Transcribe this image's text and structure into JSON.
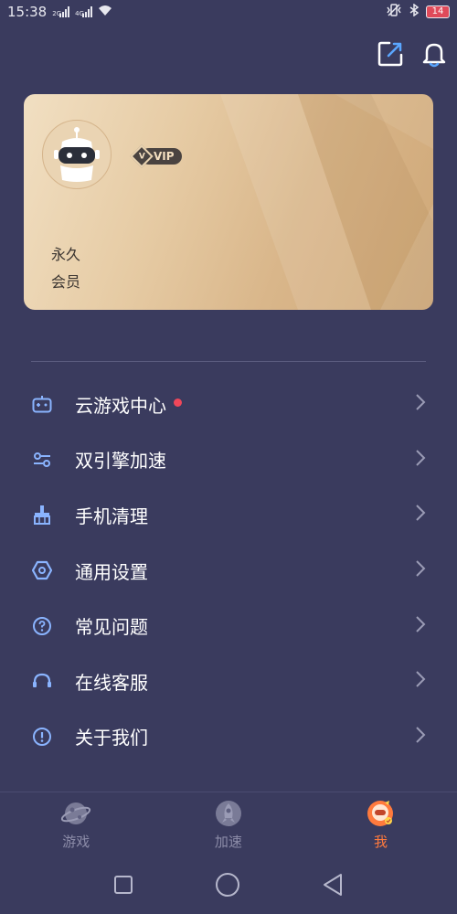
{
  "status_bar": {
    "time": "15:38",
    "net1": "2G",
    "net2": "4G",
    "battery": "14"
  },
  "header": {
    "icons": [
      "edit-icon",
      "bell-icon"
    ]
  },
  "vip_card": {
    "badge_letter": "V",
    "badge_label": "VIP",
    "member_line1": "永久",
    "member_line2": "会员"
  },
  "menu": {
    "items": [
      {
        "label": "云游戏中心",
        "icon": "gamepad-icon",
        "has_dot": true
      },
      {
        "label": "双引擎加速",
        "icon": "toggles-icon",
        "has_dot": false
      },
      {
        "label": "手机清理",
        "icon": "broom-icon",
        "has_dot": false
      },
      {
        "label": "通用设置",
        "icon": "hex-settings-icon",
        "has_dot": false
      },
      {
        "label": "常见问题",
        "icon": "question-icon",
        "has_dot": false
      },
      {
        "label": "在线客服",
        "icon": "headset-icon",
        "has_dot": false
      },
      {
        "label": "关于我们",
        "icon": "info-icon",
        "has_dot": false
      }
    ]
  },
  "bottom_nav": {
    "tabs": [
      {
        "label": "游戏",
        "icon": "planet-icon",
        "active": false
      },
      {
        "label": "加速",
        "icon": "rocket-icon",
        "active": false
      },
      {
        "label": "我",
        "icon": "astronaut-icon",
        "active": true
      }
    ]
  },
  "colors": {
    "background": "#3a3b5e",
    "accent": "#ff7a3d",
    "icon_blue": "#8ab4ff",
    "badge_red": "#f0475a"
  }
}
